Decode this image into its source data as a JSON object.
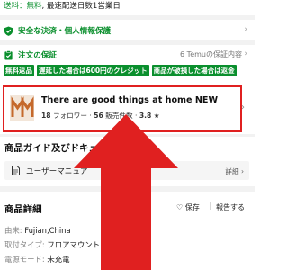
{
  "shipping": {
    "free_label": "送料：無料",
    "delivery_text": ", 最速配送日数1営業日"
  },
  "safe_payment": {
    "icon": "shield-check-icon",
    "text": "安全な決済・個人情報保護"
  },
  "order_guarantee": {
    "icon": "clipboard-icon",
    "title": "注文の保証",
    "right_text": "6 Temuの保証内容"
  },
  "guarantee_tags": [
    "無料返品",
    "遅延した場合は600円のクレジット",
    "商品が破損した場合は返金"
  ],
  "store": {
    "name": "There are good things at home NEW",
    "followers": "18",
    "followers_label": "フォロワー",
    "items_sold": "56",
    "items_sold_label": "販売件数",
    "rating": "3.8",
    "star": "★"
  },
  "guide": {
    "title": "商品ガイド及びドキュメント",
    "doc_name": "ユーザーマニュア",
    "detail_label": "詳細 ›"
  },
  "details": {
    "title": "商品詳細",
    "save_label": "保存",
    "report_label": "報告する",
    "specs": [
      {
        "key": "由来: ",
        "value": "Fujian,China"
      },
      {
        "key": "取付タイプ: ",
        "value": "フロアマウント"
      },
      {
        "key": "電源モード: ",
        "value": "未充電"
      }
    ]
  },
  "colors": {
    "green": "#0a8f2d",
    "highlight_red": "#e02020"
  }
}
